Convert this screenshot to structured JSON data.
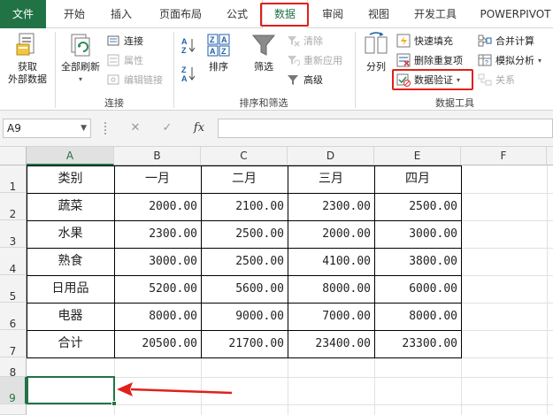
{
  "tabs": {
    "file": "文件",
    "items": [
      "开始",
      "插入",
      "页面布局",
      "公式",
      "数据",
      "审阅",
      "视图",
      "开发工具",
      "POWERPIVOT"
    ],
    "active": "数据"
  },
  "ribbon": {
    "get_external": {
      "line1": "获取",
      "line2": "外部数据"
    },
    "refresh_all": "全部刷新",
    "connections": "连接",
    "properties": "属性",
    "edit_links": "编辑链接",
    "group_connections": "连接",
    "sort": "排序",
    "filter": "筛选",
    "clear": "清除",
    "reapply": "重新应用",
    "advanced": "高级",
    "group_sort_filter": "排序和筛选",
    "text_to_columns": "分列",
    "flash_fill": "快速填充",
    "remove_dup": "删除重复项",
    "data_validation": "数据验证",
    "consolidate": "合并计算",
    "what_if": "模拟分析",
    "relationships": "关系",
    "group_data_tools": "数据工具"
  },
  "formula_bar": {
    "name_box": "A9",
    "cancel": "✕",
    "enter": "✓",
    "fx": "fx",
    "value": ""
  },
  "sheet": {
    "columns": [
      "A",
      "B",
      "C",
      "D",
      "E",
      "F"
    ],
    "rows": [
      "1",
      "2",
      "3",
      "4",
      "5",
      "6",
      "7",
      "8",
      "9"
    ],
    "selected_cell": "A9",
    "table": {
      "header": [
        "类别",
        "一月",
        "二月",
        "三月",
        "四月"
      ],
      "rows": [
        [
          "蔬菜",
          "2000.00",
          "2100.00",
          "2300.00",
          "2500.00"
        ],
        [
          "水果",
          "2300.00",
          "2500.00",
          "2000.00",
          "3000.00"
        ],
        [
          "熟食",
          "3000.00",
          "2500.00",
          "4100.00",
          "3800.00"
        ],
        [
          "日用品",
          "5200.00",
          "5600.00",
          "8000.00",
          "6000.00"
        ],
        [
          "电器",
          "8000.00",
          "9000.00",
          "7000.00",
          "8000.00"
        ],
        [
          "合计",
          "20500.00",
          "21700.00",
          "23400.00",
          "23300.00"
        ]
      ]
    }
  },
  "colors": {
    "excel_green": "#217346",
    "highlight_red": "#e0201b"
  }
}
